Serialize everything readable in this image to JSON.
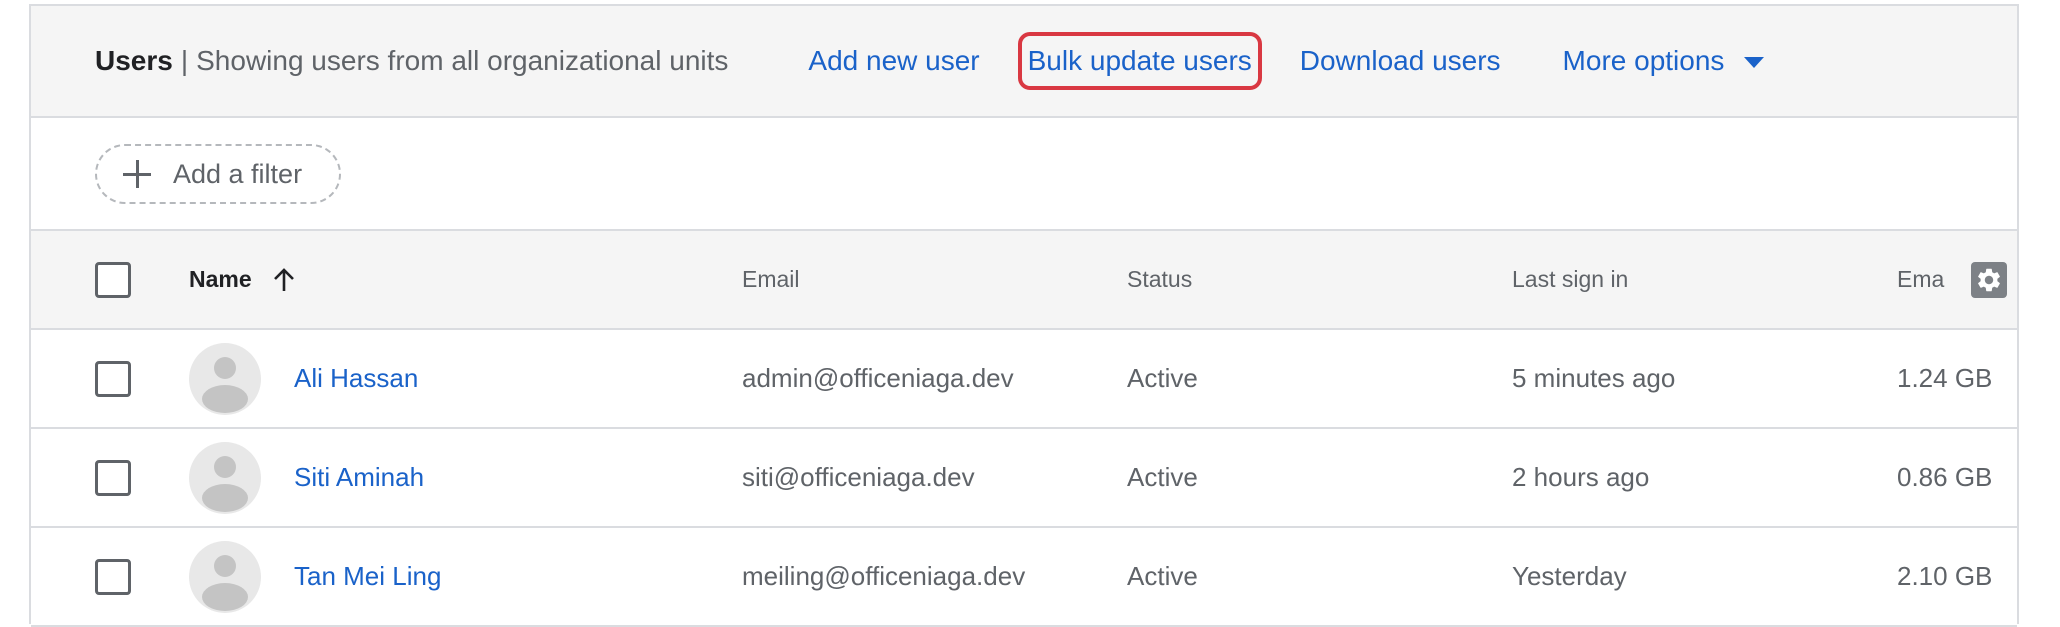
{
  "header": {
    "title": "Users",
    "separator": "|",
    "subtitle": "Showing users from all organizational units",
    "actions": {
      "add_user": "Add new user",
      "bulk_update": "Bulk update users",
      "download": "Download users",
      "more_options": "More options"
    }
  },
  "filter": {
    "label": "Add a filter"
  },
  "table": {
    "columns": {
      "name": "Name",
      "email": "Email",
      "status": "Status",
      "last_sign_in": "Last sign in",
      "storage": "Ema"
    },
    "sort": {
      "column": "Name",
      "direction": "ascending",
      "icon": "arrow-up-icon"
    },
    "rows": [
      {
        "name": "Ali Hassan",
        "email": "admin@officeniaga.dev",
        "status": "Active",
        "last_sign_in": "5 minutes ago",
        "storage": "1.24 GB"
      },
      {
        "name": "Siti Aminah",
        "email": "siti@officeniaga.dev",
        "status": "Active",
        "last_sign_in": "2 hours ago",
        "storage": "0.86 GB"
      },
      {
        "name": "Tan Mei Ling",
        "email": "meiling@officeniaga.dev",
        "status": "Active",
        "last_sign_in": "Yesterday",
        "storage": "2.10 GB"
      }
    ]
  },
  "colors": {
    "link": "#1a62c9",
    "highlight_border": "#d93842",
    "header_bg": "#f5f5f5",
    "divider": "#dadce0"
  }
}
